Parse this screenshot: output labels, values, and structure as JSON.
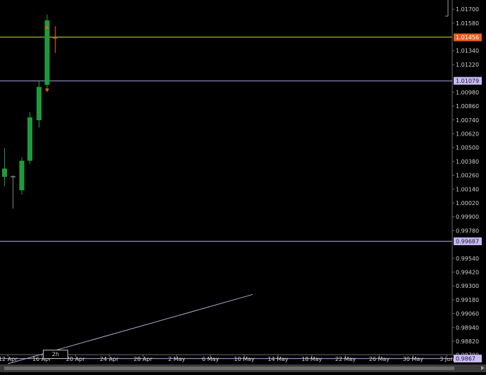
{
  "chart_data": {
    "type": "candlestick",
    "timeframe": "2h",
    "price_labels": [
      "1.01700",
      "1.01580",
      "1.01340",
      "1.01220",
      "1.00980",
      "1.00860",
      "1.00740",
      "1.00620",
      "1.00500",
      "1.00380",
      "1.00260",
      "1.00140",
      "1.00020",
      "0.99900",
      "0.99780",
      "0.99540",
      "0.99420",
      "0.99300",
      "0.99180",
      "0.99060",
      "0.98940",
      "0.98820",
      "0.98700"
    ],
    "date_labels": [
      "12 Apr",
      "16 Apr",
      "20 Apr",
      "24 Apr",
      "28 Apr",
      "2 May",
      "6 May",
      "10 May",
      "14 May",
      "18 May",
      "22 May",
      "26 May",
      "30 May",
      "3 Jun"
    ],
    "ylim": [
      0.98625,
      1.0178
    ],
    "current_price": {
      "label": "1.01456",
      "value": 1.01456,
      "color": "#e8601c"
    },
    "horizontal_lines": [
      {
        "label": "1.01079",
        "value": 1.01079,
        "color": "#b7a8e6"
      },
      {
        "label": "0.99687",
        "value": 0.99687,
        "color": "#b7a8e6"
      },
      {
        "label": "0.9867",
        "value": 0.9867,
        "color": "#b7a8e6"
      }
    ],
    "trendline": {
      "start": {
        "date": "12 Apr",
        "value": 0.98625
      },
      "end": {
        "date": "11 May",
        "value": 0.99226
      },
      "color": "#a9a9cf"
    },
    "candles": [
      {
        "date": "12 Apr",
        "open": 1.00318,
        "high": 1.00497,
        "low": 1.00164,
        "close": 1.00246,
        "color": "#1e9b3c"
      },
      {
        "date": "14 Apr",
        "open": 1.00251,
        "high": 1.0026,
        "low": 0.9997,
        "close": 1.00251,
        "color": "#808080"
      },
      {
        "date": "15 Apr",
        "open": 1.0013,
        "high": 1.00415,
        "low": 1.00094,
        "close": 1.00386,
        "color": "#1e9b3c"
      },
      {
        "date": "15 Apr",
        "open": 1.00386,
        "high": 1.00806,
        "low": 1.00357,
        "close": 1.00762,
        "color": "#1e9b3c"
      },
      {
        "date": "16 Apr",
        "open": 1.00738,
        "high": 1.01079,
        "low": 1.00673,
        "close": 1.01026,
        "color": "#1e9b3c"
      },
      {
        "date": "17 Apr",
        "open": 1.01044,
        "high": 1.01654,
        "low": 1.01002,
        "close": 1.01603,
        "color": "#1e9b3c"
      },
      {
        "date": "18 Apr",
        "open": 1.01456,
        "high": 1.01552,
        "low": 1.0132,
        "close": 1.01456,
        "color": "#e8601c"
      }
    ],
    "markers": [
      {
        "date": "17 Apr",
        "value": 1.01542,
        "shape": "up",
        "color": "#e8601c"
      },
      {
        "date": "17 Apr",
        "value": 1.01,
        "shape": "down",
        "color": "#e8601c"
      }
    ]
  },
  "timeframe_badge": "2h"
}
